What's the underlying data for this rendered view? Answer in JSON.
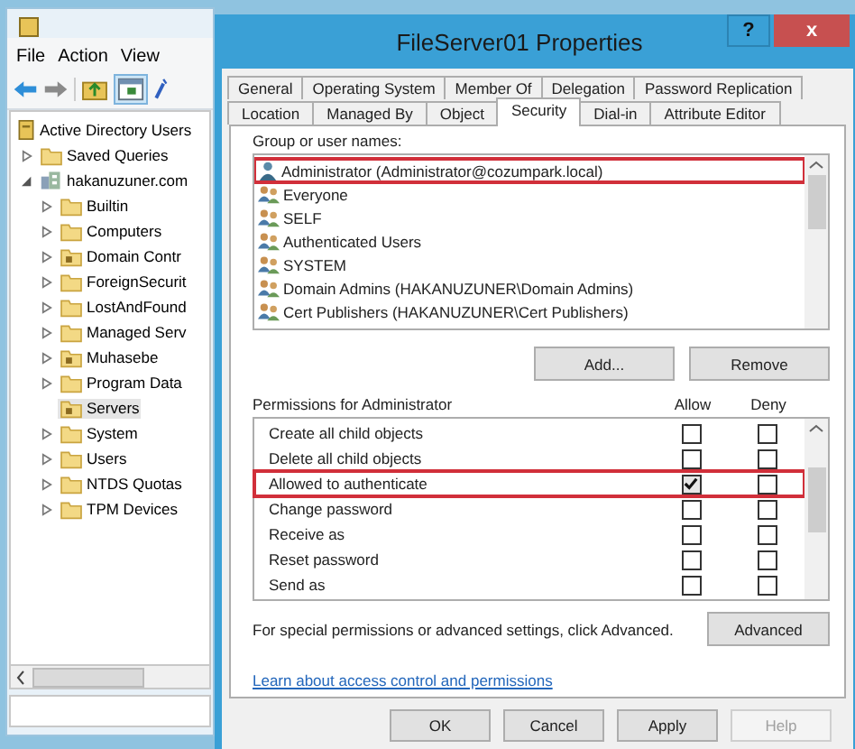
{
  "main_window": {
    "menu": [
      "File",
      "Action",
      "View"
    ],
    "tree": [
      {
        "label": "Active Directory Users",
        "kind": "root",
        "selected": false,
        "children": [
          {
            "label": "Saved Queries",
            "kind": "folder",
            "selected": false,
            "expanded": false
          },
          {
            "label": "hakanuzuner.com",
            "kind": "domain",
            "selected": false,
            "expanded": true,
            "children": [
              {
                "label": "Builtin",
                "kind": "folder",
                "selected": false,
                "expanded": false
              },
              {
                "label": "Computers",
                "kind": "folder",
                "selected": false,
                "expanded": false
              },
              {
                "label": "Domain Contr",
                "kind": "ou",
                "selected": false,
                "expanded": false
              },
              {
                "label": "ForeignSecurit",
                "kind": "folder",
                "selected": false,
                "expanded": false
              },
              {
                "label": "LostAndFound",
                "kind": "folder",
                "selected": false,
                "expanded": false
              },
              {
                "label": "Managed Serv",
                "kind": "folder",
                "selected": false,
                "expanded": false
              },
              {
                "label": "Muhasebe",
                "kind": "ou",
                "selected": false,
                "expanded": false
              },
              {
                "label": "Program Data",
                "kind": "folder",
                "selected": false,
                "expanded": false
              },
              {
                "label": "Servers",
                "kind": "ou",
                "selected": true
              },
              {
                "label": "System",
                "kind": "folder",
                "selected": false,
                "expanded": false
              },
              {
                "label": "Users",
                "kind": "folder",
                "selected": false,
                "expanded": false
              },
              {
                "label": "NTDS Quotas",
                "kind": "folder",
                "selected": false,
                "expanded": false
              },
              {
                "label": "TPM Devices",
                "kind": "folder",
                "selected": false,
                "expanded": false
              }
            ]
          }
        ]
      }
    ]
  },
  "dialog": {
    "title": "FileServer01 Properties",
    "help": "?",
    "close": "x",
    "tab_rows": [
      [
        {
          "label": "General",
          "selected": false
        },
        {
          "label": "Operating System",
          "selected": false
        },
        {
          "label": "Member Of",
          "selected": false
        },
        {
          "label": "Delegation",
          "selected": false
        },
        {
          "label": "Password Replication",
          "selected": false
        }
      ],
      [
        {
          "label": "Location",
          "selected": false
        },
        {
          "label": "Managed By",
          "selected": false
        },
        {
          "label": "Object",
          "selected": false
        },
        {
          "label": "Security",
          "selected": true
        },
        {
          "label": "Dial-in",
          "selected": false
        },
        {
          "label": "Attribute Editor",
          "selected": false
        }
      ]
    ],
    "group_label": "Group or user names:",
    "principals": [
      {
        "name": "Administrator (Administrator@cozumpark.local)",
        "kind": "user",
        "highlighted": true
      },
      {
        "name": "Everyone",
        "kind": "group",
        "highlighted": false
      },
      {
        "name": "SELF",
        "kind": "group",
        "highlighted": false
      },
      {
        "name": "Authenticated Users",
        "kind": "group",
        "highlighted": false
      },
      {
        "name": "SYSTEM",
        "kind": "group",
        "highlighted": false
      },
      {
        "name": "Domain Admins (HAKANUZUNER\\Domain Admins)",
        "kind": "group",
        "highlighted": false
      },
      {
        "name": "Cert Publishers (HAKANUZUNER\\Cert Publishers)",
        "kind": "group",
        "highlighted": false
      }
    ],
    "add_button": "Add...",
    "remove_button": "Remove",
    "permissions_label": "Permissions for Administrator",
    "allow_header": "Allow",
    "deny_header": "Deny",
    "permissions": [
      {
        "name": "Create all child objects",
        "allow": false,
        "deny": false,
        "highlighted": false
      },
      {
        "name": "Delete all child objects",
        "allow": false,
        "deny": false,
        "highlighted": false
      },
      {
        "name": "Allowed to authenticate",
        "allow": true,
        "deny": false,
        "highlighted": true
      },
      {
        "name": "Change password",
        "allow": false,
        "deny": false,
        "highlighted": false
      },
      {
        "name": "Receive as",
        "allow": false,
        "deny": false,
        "highlighted": false
      },
      {
        "name": "Reset password",
        "allow": false,
        "deny": false,
        "highlighted": false
      },
      {
        "name": "Send as",
        "allow": false,
        "deny": false,
        "highlighted": false
      }
    ],
    "advanced_note": "For special permissions or advanced settings, click Advanced.",
    "advanced_button": "Advanced",
    "link": "Learn about access control and permissions",
    "buttons": [
      {
        "label": "OK",
        "disabled": false
      },
      {
        "label": "Cancel",
        "disabled": false
      },
      {
        "label": "Apply",
        "disabled": false
      },
      {
        "label": "Help",
        "disabled": true
      }
    ]
  }
}
